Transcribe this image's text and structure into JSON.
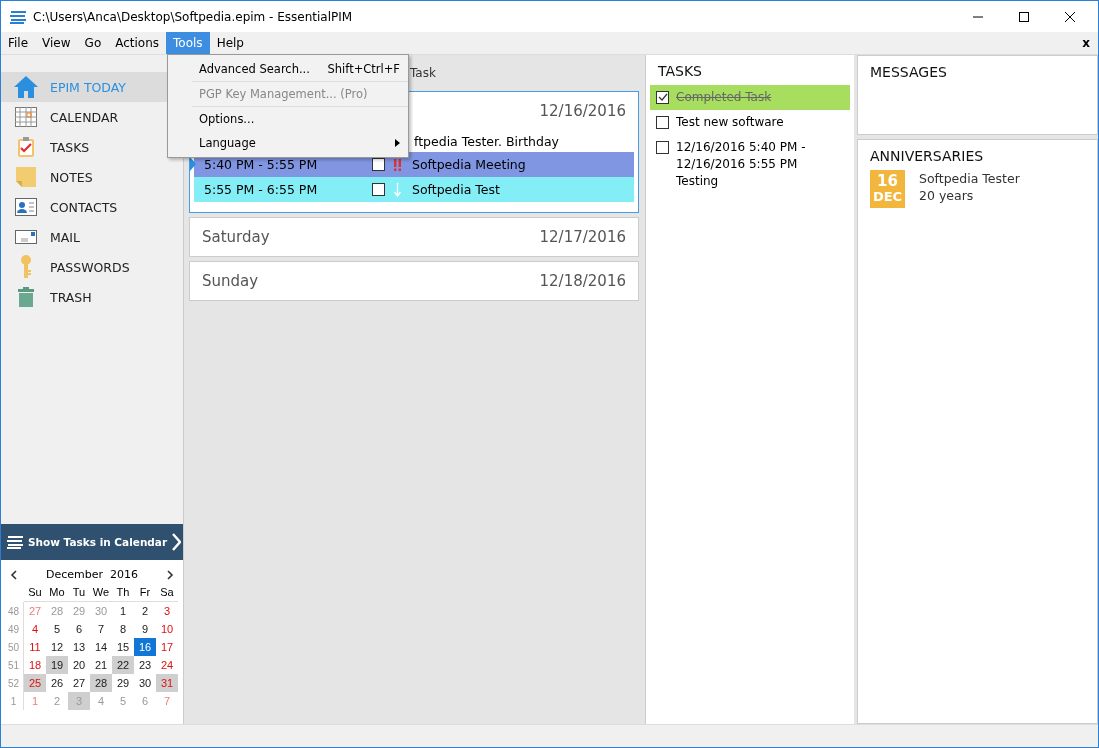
{
  "window": {
    "title": "C:\\Users\\Anca\\Desktop\\Softpedia.epim - EssentialPIM"
  },
  "menu": [
    {
      "label": "File",
      "selected": false
    },
    {
      "label": "View",
      "selected": false
    },
    {
      "label": "Go",
      "selected": false
    },
    {
      "label": "Actions",
      "selected": false
    },
    {
      "label": "Tools",
      "selected": true
    },
    {
      "label": "Help",
      "selected": false
    }
  ],
  "menu_close": "x",
  "dropdown": [
    {
      "label": "Advanced Search...",
      "shortcut": "Shift+Ctrl+F",
      "disabled": false,
      "submenu": false
    },
    {
      "label": "PGP Key Management... (Pro)",
      "disabled": true,
      "submenu": false
    },
    {
      "label": "Options...",
      "disabled": false,
      "submenu": false
    },
    {
      "label": "Language",
      "disabled": false,
      "submenu": true
    }
  ],
  "sidebar": {
    "items": [
      {
        "label": "EPIM TODAY",
        "kind": "today",
        "selected": true
      },
      {
        "label": "CALENDAR",
        "kind": "calendar",
        "selected": false
      },
      {
        "label": "TASKS",
        "kind": "tasks",
        "selected": false
      },
      {
        "label": "NOTES",
        "kind": "notes",
        "selected": false
      },
      {
        "label": "CONTACTS",
        "kind": "contacts",
        "selected": false
      },
      {
        "label": "MAIL",
        "kind": "mail",
        "selected": false
      },
      {
        "label": "PASSWORDS",
        "kind": "passwords",
        "selected": false
      },
      {
        "label": "TRASH",
        "kind": "trash",
        "selected": false
      }
    ],
    "show_tasks_button": "Show Tasks in Calendar"
  },
  "mini_calendar": {
    "month": "December",
    "year": "2016",
    "weekdays": [
      "Su",
      "Mo",
      "Tu",
      "We",
      "Th",
      "Fr",
      "Sa"
    ],
    "weeks": [
      {
        "number": "48",
        "days": [
          {
            "d": "27",
            "outside": true,
            "weekend": true,
            "marked": false,
            "selected": false
          },
          {
            "d": "28",
            "outside": true,
            "weekend": false,
            "marked": false,
            "selected": false
          },
          {
            "d": "29",
            "outside": true,
            "weekend": false,
            "marked": false,
            "selected": false
          },
          {
            "d": "30",
            "outside": true,
            "weekend": false,
            "marked": false,
            "selected": false
          },
          {
            "d": "1",
            "outside": false,
            "weekend": false,
            "marked": false,
            "selected": false
          },
          {
            "d": "2",
            "outside": false,
            "weekend": false,
            "marked": false,
            "selected": false
          },
          {
            "d": "3",
            "outside": false,
            "weekend": true,
            "marked": false,
            "selected": false
          }
        ]
      },
      {
        "number": "49",
        "days": [
          {
            "d": "4",
            "outside": false,
            "weekend": true,
            "marked": false,
            "selected": false
          },
          {
            "d": "5",
            "outside": false,
            "weekend": false,
            "marked": false,
            "selected": false
          },
          {
            "d": "6",
            "outside": false,
            "weekend": false,
            "marked": false,
            "selected": false
          },
          {
            "d": "7",
            "outside": false,
            "weekend": false,
            "marked": false,
            "selected": false
          },
          {
            "d": "8",
            "outside": false,
            "weekend": false,
            "marked": false,
            "selected": false
          },
          {
            "d": "9",
            "outside": false,
            "weekend": false,
            "marked": false,
            "selected": false
          },
          {
            "d": "10",
            "outside": false,
            "weekend": true,
            "marked": false,
            "selected": false
          }
        ]
      },
      {
        "number": "50",
        "days": [
          {
            "d": "11",
            "outside": false,
            "weekend": true,
            "marked": false,
            "selected": false
          },
          {
            "d": "12",
            "outside": false,
            "weekend": false,
            "marked": false,
            "selected": false
          },
          {
            "d": "13",
            "outside": false,
            "weekend": false,
            "marked": false,
            "selected": false
          },
          {
            "d": "14",
            "outside": false,
            "weekend": false,
            "marked": false,
            "selected": false
          },
          {
            "d": "15",
            "outside": false,
            "weekend": false,
            "marked": false,
            "selected": false
          },
          {
            "d": "16",
            "outside": false,
            "weekend": false,
            "marked": false,
            "selected": true
          },
          {
            "d": "17",
            "outside": false,
            "weekend": true,
            "marked": false,
            "selected": false
          }
        ]
      },
      {
        "number": "51",
        "days": [
          {
            "d": "18",
            "outside": false,
            "weekend": true,
            "marked": false,
            "selected": false
          },
          {
            "d": "19",
            "outside": false,
            "weekend": false,
            "marked": true,
            "selected": false
          },
          {
            "d": "20",
            "outside": false,
            "weekend": false,
            "marked": false,
            "selected": false
          },
          {
            "d": "21",
            "outside": false,
            "weekend": false,
            "marked": false,
            "selected": false
          },
          {
            "d": "22",
            "outside": false,
            "weekend": false,
            "marked": true,
            "selected": false
          },
          {
            "d": "23",
            "outside": false,
            "weekend": false,
            "marked": false,
            "selected": false
          },
          {
            "d": "24",
            "outside": false,
            "weekend": true,
            "marked": false,
            "selected": false
          }
        ]
      },
      {
        "number": "52",
        "days": [
          {
            "d": "25",
            "outside": false,
            "weekend": true,
            "marked": true,
            "selected": false
          },
          {
            "d": "26",
            "outside": false,
            "weekend": false,
            "marked": false,
            "selected": false
          },
          {
            "d": "27",
            "outside": false,
            "weekend": false,
            "marked": false,
            "selected": false
          },
          {
            "d": "28",
            "outside": false,
            "weekend": false,
            "marked": true,
            "selected": false
          },
          {
            "d": "29",
            "outside": false,
            "weekend": false,
            "marked": false,
            "selected": false
          },
          {
            "d": "30",
            "outside": false,
            "weekend": false,
            "marked": false,
            "selected": false
          },
          {
            "d": "31",
            "outside": false,
            "weekend": true,
            "marked": true,
            "selected": false
          }
        ]
      },
      {
        "number": "1",
        "days": [
          {
            "d": "1",
            "outside": true,
            "weekend": true,
            "marked": false,
            "selected": false
          },
          {
            "d": "2",
            "outside": true,
            "weekend": false,
            "marked": false,
            "selected": false
          },
          {
            "d": "3",
            "outside": true,
            "weekend": false,
            "marked": true,
            "selected": false
          },
          {
            "d": "4",
            "outside": true,
            "weekend": false,
            "marked": false,
            "selected": false
          },
          {
            "d": "5",
            "outside": true,
            "weekend": false,
            "marked": false,
            "selected": false
          },
          {
            "d": "6",
            "outside": true,
            "weekend": false,
            "marked": false,
            "selected": false
          },
          {
            "d": "7",
            "outside": true,
            "weekend": true,
            "marked": false,
            "selected": false
          }
        ]
      }
    ]
  },
  "toolbar": {
    "visible_item": "Task"
  },
  "days": [
    {
      "date": "12/16/2016",
      "current": true,
      "events": [
        {
          "kind": "anniversary",
          "title": "ftpedia Tester. Birthday"
        },
        {
          "kind": "appointment",
          "time": "5:40 PM - 5:55 PM",
          "title": "Softpedia Meeting",
          "high_priority": true,
          "low_priority": false,
          "checked": false,
          "color": "#8096e2",
          "selected": true
        },
        {
          "kind": "appointment",
          "time": "5:55 PM - 6:55 PM",
          "title": "Softpedia Test",
          "high_priority": false,
          "low_priority": true,
          "checked": false,
          "color": "#84eef6",
          "selected": false
        }
      ]
    },
    {
      "name": "Saturday",
      "date": "12/17/2016",
      "current": false
    },
    {
      "name": "Sunday",
      "date": "12/18/2016",
      "current": false
    }
  ],
  "tasks": {
    "title": "TASKS",
    "items": [
      {
        "text": "Completed Task",
        "checked": true
      },
      {
        "text": "Test new software",
        "checked": false
      },
      {
        "text": "12/16/2016 5:40 PM - 12/16/2016 5:55 PM Testing",
        "checked": false
      }
    ]
  },
  "messages": {
    "title": "MESSAGES"
  },
  "anniversaries": {
    "title": "ANNIVERSARIES",
    "items": [
      {
        "day": "16",
        "month": "DEC",
        "name": "Softpedia Tester",
        "years": "20 years"
      }
    ]
  }
}
